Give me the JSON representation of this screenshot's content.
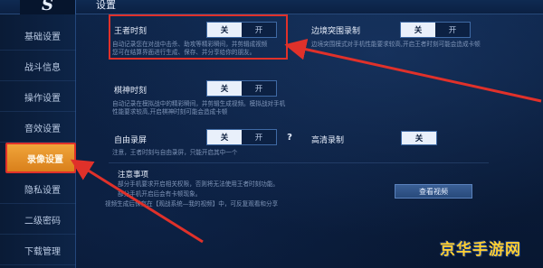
{
  "header": {
    "title": "设置"
  },
  "sidebar": {
    "items": [
      {
        "label": "基础设置"
      },
      {
        "label": "战斗信息"
      },
      {
        "label": "操作设置"
      },
      {
        "label": "音效设置"
      },
      {
        "label": "录像设置",
        "active": true
      },
      {
        "label": "隐私设置"
      },
      {
        "label": "二级密码"
      },
      {
        "label": "下载管理"
      }
    ]
  },
  "wzsk": {
    "label": "王者时刻",
    "toggle_off": "关",
    "toggle_on": "开",
    "state": "关",
    "desc_line1": "自动记录您在对战中击杀、助攻等精彩瞬间，并剪辑成视频",
    "desc_line2": "您可在结算界面进行生成、保存、并分享给你的朋友。"
  },
  "bkjt": {
    "label": "边境突围录制",
    "toggle_off": "关",
    "toggle_on": "开",
    "state": "关",
    "desc": "边境突围模式对手机性能要求较高,开启王者时刻可能会造成卡顿"
  },
  "qssk": {
    "label": "棋神时刻",
    "toggle_off": "关",
    "toggle_on": "开",
    "state": "关",
    "desc_line1": "自动记录在模拟战中的精彩瞬间，并剪辑生成视频。模拟战对手机",
    "desc_line2": "性能要求较高,开启棋神时刻可能会造成卡顿"
  },
  "zyly": {
    "label": "自由录屏",
    "toggle_off": "关",
    "toggle_on": "开",
    "state": "关",
    "help": "?",
    "desc": "注意，王者时刻与自由录屏，只能开启其中一个"
  },
  "gqlz": {
    "label": "高清录制",
    "toggle_on": "关"
  },
  "notes": {
    "title": "注意事项",
    "line1": "部分手机要求开启相关权限，否则将无法使用王者时刻功能。",
    "line2": "部分手机开启后会有卡顿现象。",
    "line3": "视频生成后保存在【观战系统—我的视频】中，可反复观看和分享",
    "button": "查看视频"
  },
  "watermark": "京华手游网",
  "colors": {
    "background": "#0b1e3d",
    "active_tab": "#e9932a",
    "annotation_red": "#e0312a",
    "toggle_selected": "#e9f0fb",
    "watermark": "#ffcf33"
  }
}
